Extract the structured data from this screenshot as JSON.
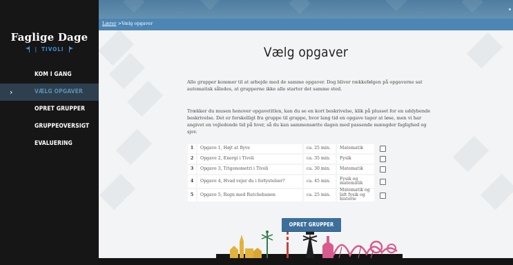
{
  "sidebar": {
    "logo_title": "Faglige Dage",
    "logo_sub": "TIVOLI",
    "items": [
      {
        "label": "KOM I GANG",
        "active": false
      },
      {
        "label": "VÆLG OPGAVER",
        "active": true
      },
      {
        "label": "OPRET GRUPPER",
        "active": false
      },
      {
        "label": "GRUPPEOVERSIGT",
        "active": false
      },
      {
        "label": "EVALUERING",
        "active": false
      }
    ]
  },
  "breadcrumb": {
    "parent": "Lærer",
    "separator": " >",
    "current": "Vælg opgaver"
  },
  "main": {
    "title": "Vælg opgaver",
    "paragraph1": "Alle grupper kommer til at arbejde med de samme opgaver. Dog bliver rækkefølgen på opgaverne sat automatisk således, at grupperne ikke alle starter det samme sted.",
    "paragraph2": "Trækker du musen henover opgavetitlen, kan du se en kort beskrivelse, klik på plusset for en uddybende beskrivelse. Det er forskelligt fra gruppe til gruppe, hvor lang tid en opgave tager at løse, men vi har angivet en vejledende tid på hver, så du kan sammensætte dagen med passende mængder faglighed og sjov.",
    "tasks": [
      {
        "num": "1",
        "name": "Opgave 1, Højt at flyve",
        "time": "ca. 25 min.",
        "subject": "Matematik"
      },
      {
        "num": "2",
        "name": "Opgave 2, Energi i Tivoli",
        "time": "ca. 35 min.",
        "subject": "Fysik"
      },
      {
        "num": "3",
        "name": "Opgave 3, Trigonometri i Tivoli",
        "time": "ca. 30 min.",
        "subject": "Matematik"
      },
      {
        "num": "4",
        "name": "Opgave 4, Hvad vejer du i forlystelser?",
        "time": "ca. 45 min.",
        "subject": "Fysik og matematik"
      },
      {
        "num": "5",
        "name": "Opgave 5, Regn med Rutchebanen",
        "time": "ca. 25 min.",
        "subject": "Matematik og lidt fysik og historie"
      }
    ],
    "button_label": "OPRET GRUPPER"
  },
  "colors": {
    "sidebar_bg": "#161616",
    "active_item_bg": "#2e3f4e",
    "accent_blue": "#4c86b5",
    "button_bg": "#3d6f9b",
    "skyline_yellow": "#e3b23c",
    "skyline_pink": "#d95a8c"
  },
  "icons": {
    "active_marker": "chevron-right-icon",
    "logo_flags": "flag-icon"
  }
}
